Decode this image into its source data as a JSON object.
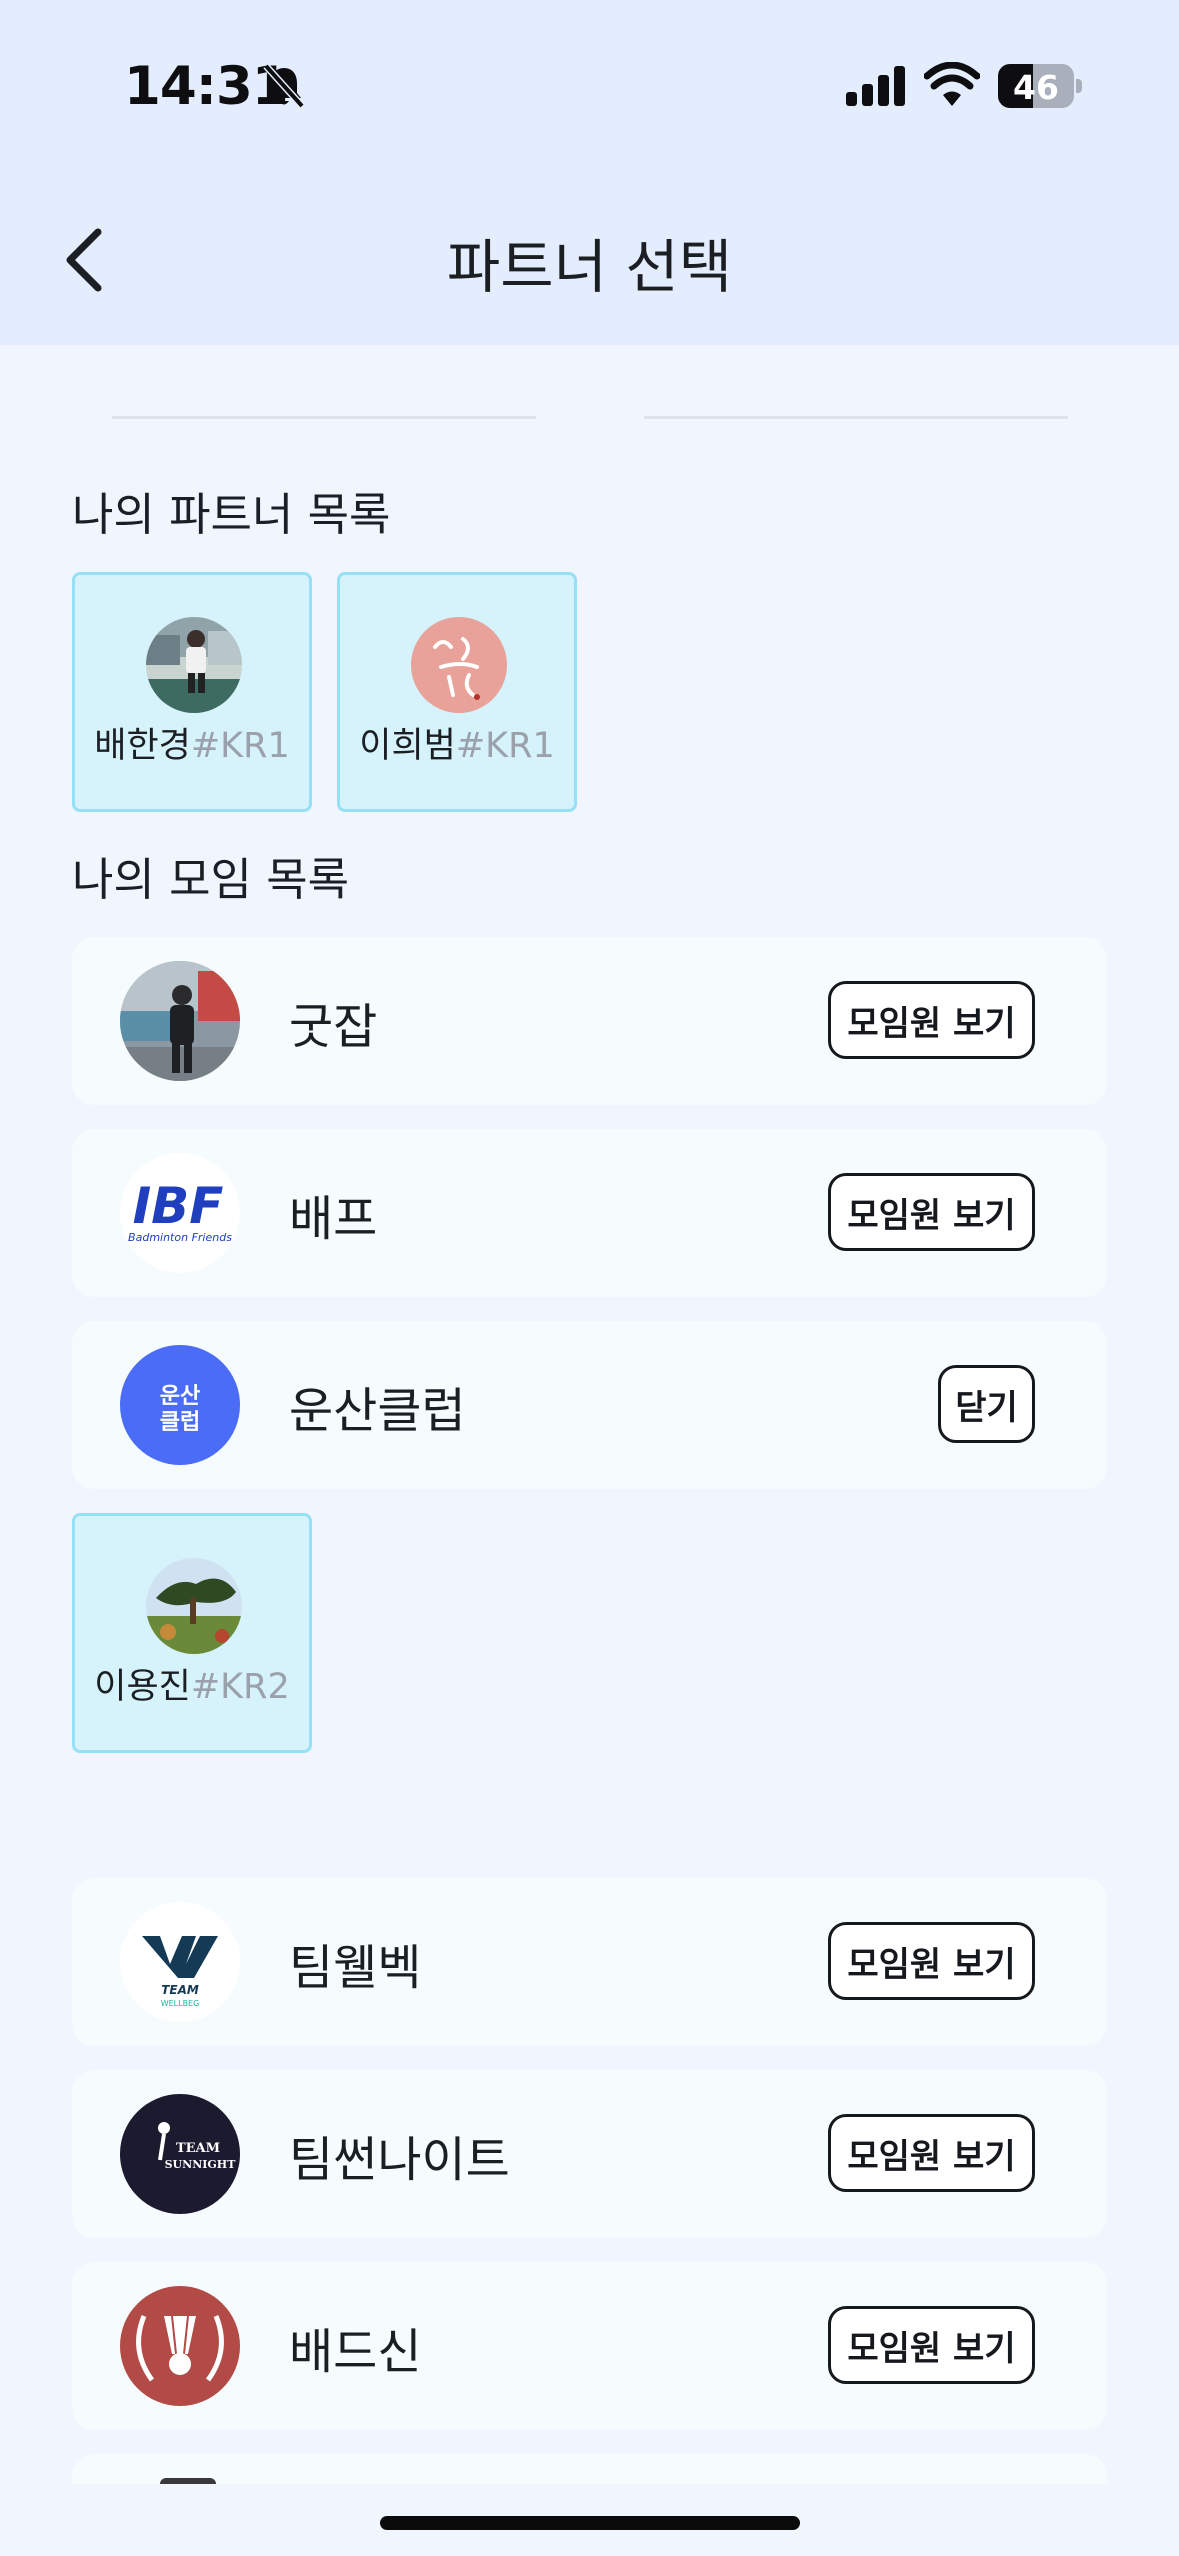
{
  "status_bar": {
    "time": "14:31",
    "battery_level": "46",
    "battery_fraction": 0.46,
    "icons": [
      "bell-muted-icon",
      "cellular-signal-icon",
      "wifi-icon",
      "battery-icon"
    ]
  },
  "header": {
    "title": "파트너 선택",
    "back_icon": "chevron-left-icon",
    "background": "#e4edfd"
  },
  "partners_section": {
    "heading": "나의 파트너 목록",
    "partners": [
      {
        "name": "배한경",
        "tag": "#KR1",
        "avatar": "photo-person-icon"
      },
      {
        "name": "이희범",
        "tag": "#KR1",
        "avatar": "calligraphy-logo-icon"
      }
    ]
  },
  "groups_section": {
    "heading": "나의 모임 목록",
    "groups": [
      {
        "name": "굿잡",
        "button": "모임원 보기",
        "avatar": "photo-group-icon"
      },
      {
        "name": "배프",
        "button": "모임원 보기",
        "avatar": "bf-logo-icon",
        "logo_text": "Badminton Friends"
      },
      {
        "name": "운산클럽",
        "button": "닫기",
        "avatar": "club-initials-icon",
        "avatar_text": "운산\n클럽",
        "expanded": true,
        "members": [
          {
            "name": "이용진",
            "tag": "#KR2",
            "avatar": "photo-tree-icon"
          }
        ]
      },
      {
        "name": "팀웰벡",
        "button": "모임원 보기",
        "avatar": "team-wellbeg-logo-icon",
        "logo_text": "TEAM WELLBEG"
      },
      {
        "name": "팀썬나이트",
        "button": "모임원 보기",
        "avatar": "team-sunnight-logo-icon",
        "logo_text": "TEAM SUNNIGHT"
      },
      {
        "name": "배드신",
        "button": "모임원 보기",
        "avatar": "shuttlecock-laurel-logo-icon"
      }
    ]
  },
  "colors": {
    "page_background": "#f0f5fe",
    "partner_card": "#d6f2fb",
    "partner_card_border": "#96e1f6",
    "group_row": "#f6fbfe",
    "club_blue": "#4a6cf7",
    "tag_gray": "#9aa1aa"
  }
}
